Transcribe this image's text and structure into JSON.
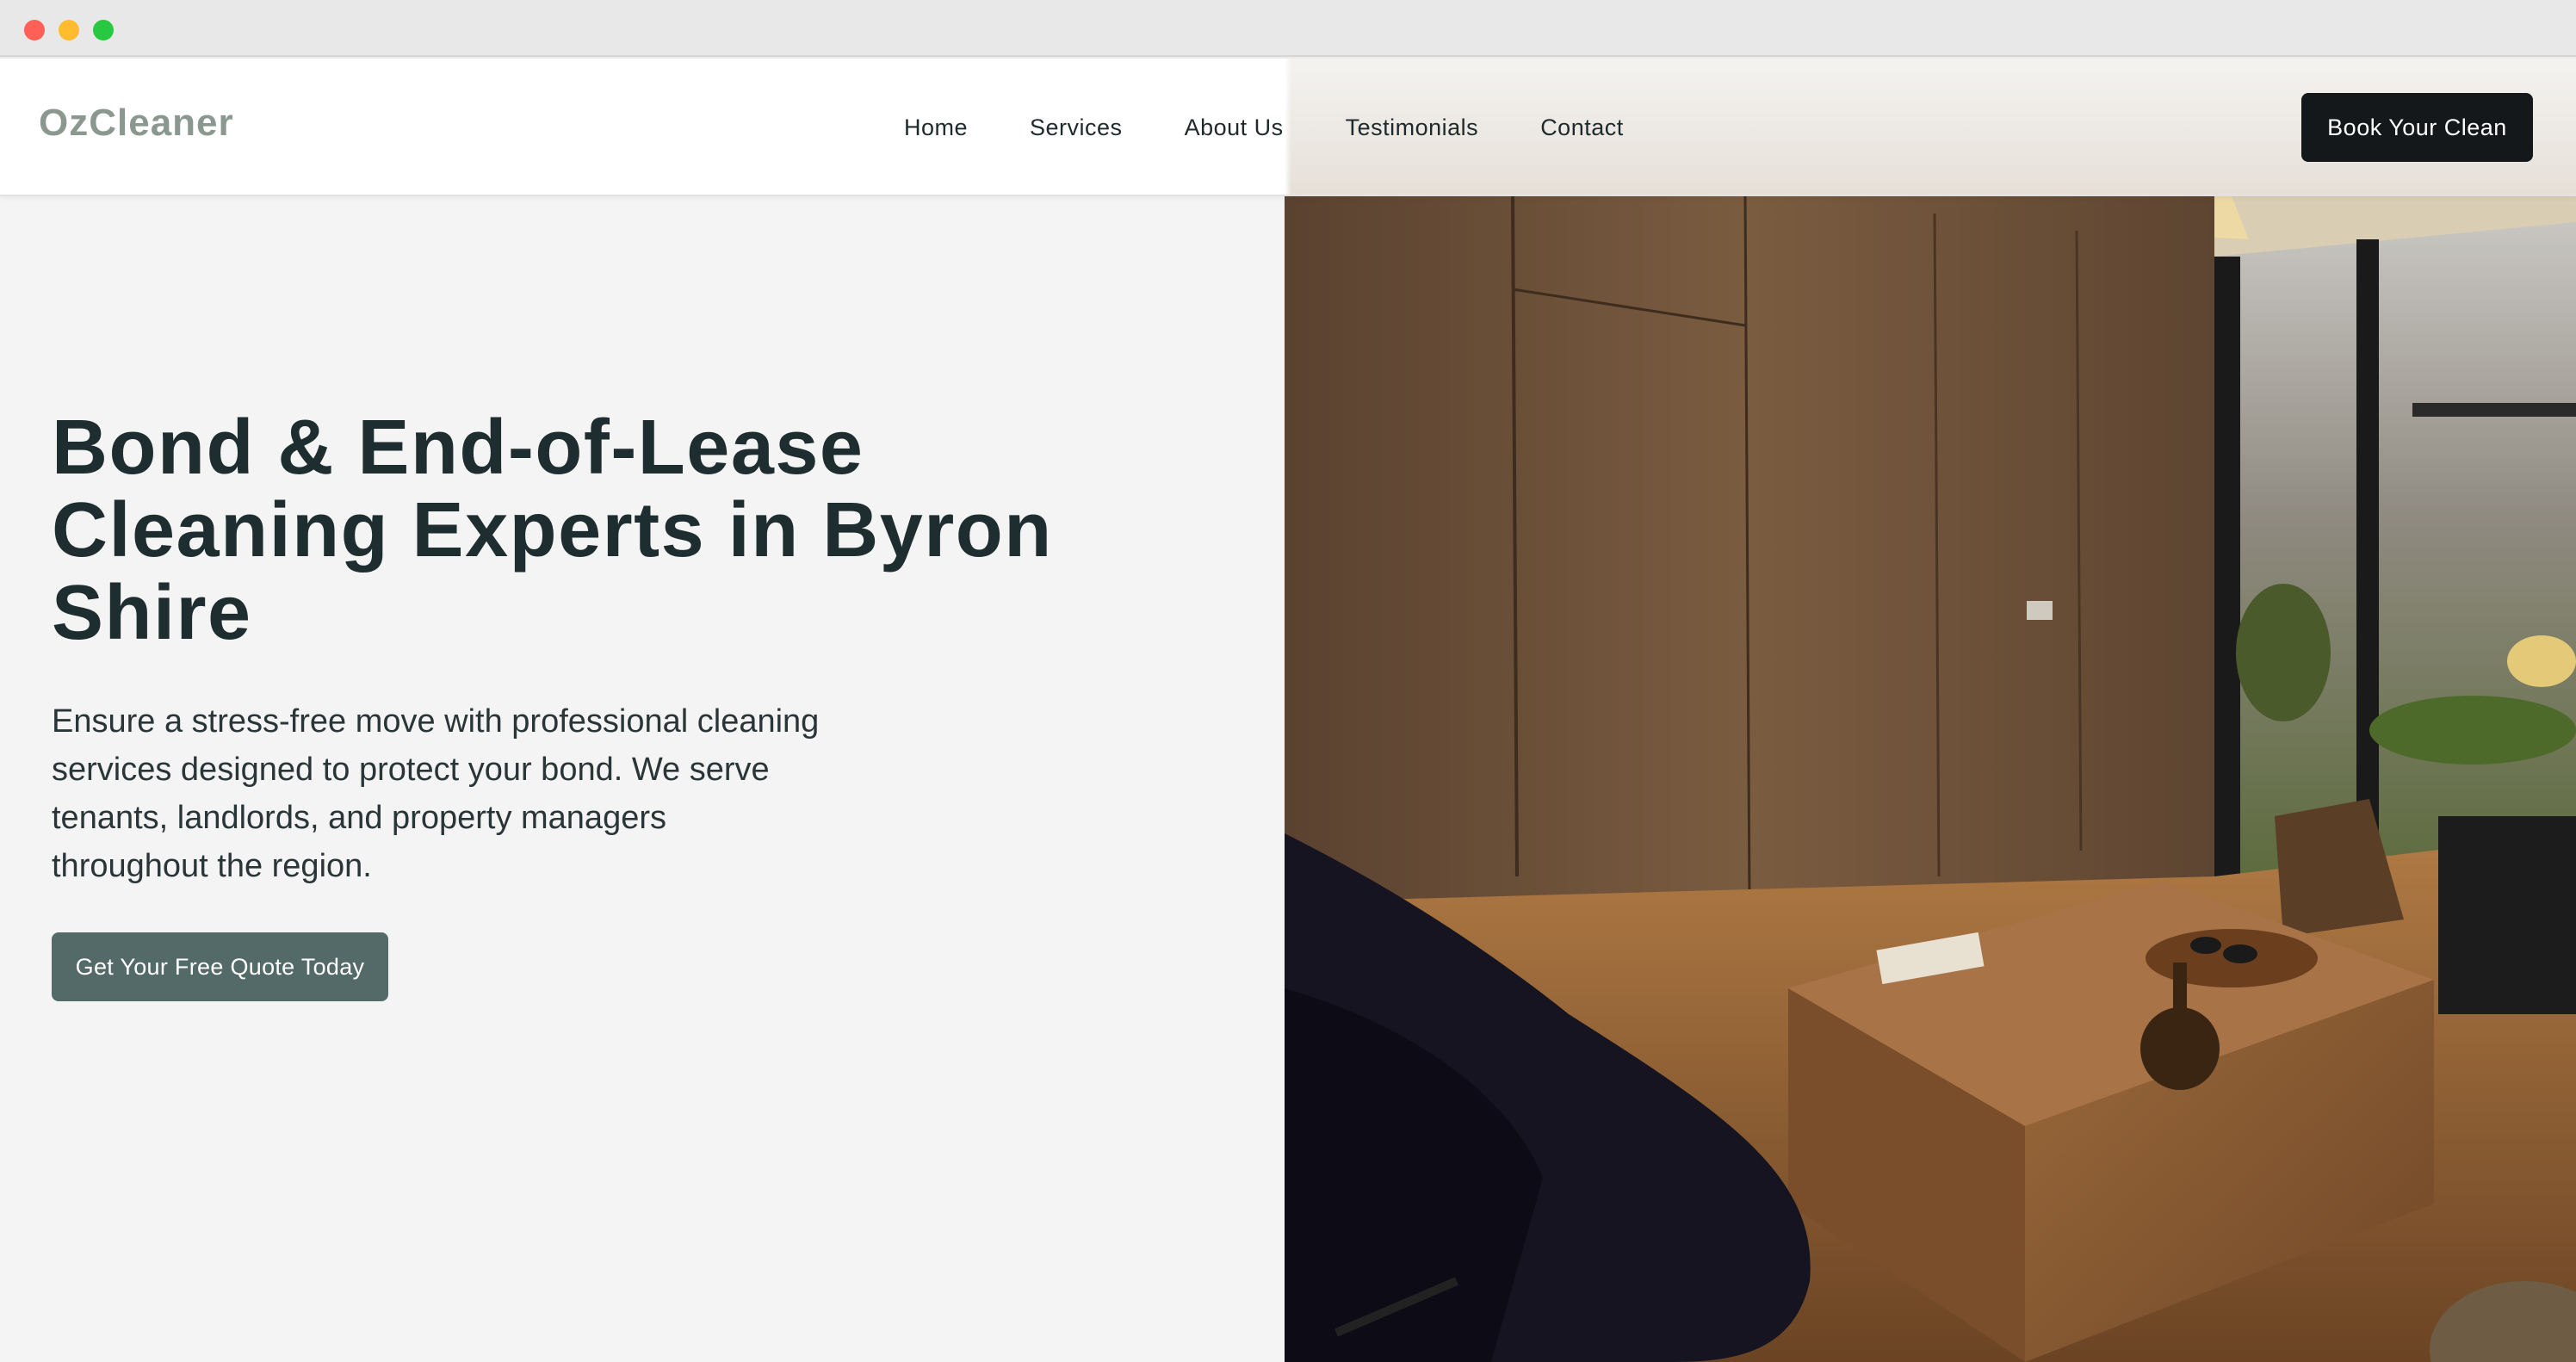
{
  "nav": {
    "logo": "OzCleaner",
    "links": [
      "Home",
      "Services",
      "About Us",
      "Testimonials",
      "Contact"
    ],
    "cta": "Book Your Clean"
  },
  "hero": {
    "title": "Bond & End-of-Lease Cleaning Experts in Byron Shire",
    "description": "Ensure a stress-free move with professional cleaning services designed to protect your bond. We serve tenants, landlords, and property managers throughout the region.",
    "button": "Get Your Free Quote Today"
  },
  "colors": {
    "logo": "#8a9890",
    "primary_dark": "#14181a",
    "accent": "#546a68",
    "heading": "#1e2d2f",
    "page_bg": "#f4f4f4"
  },
  "icons": [
    "window-close-dot",
    "window-minimize-dot",
    "window-zoom-dot"
  ]
}
